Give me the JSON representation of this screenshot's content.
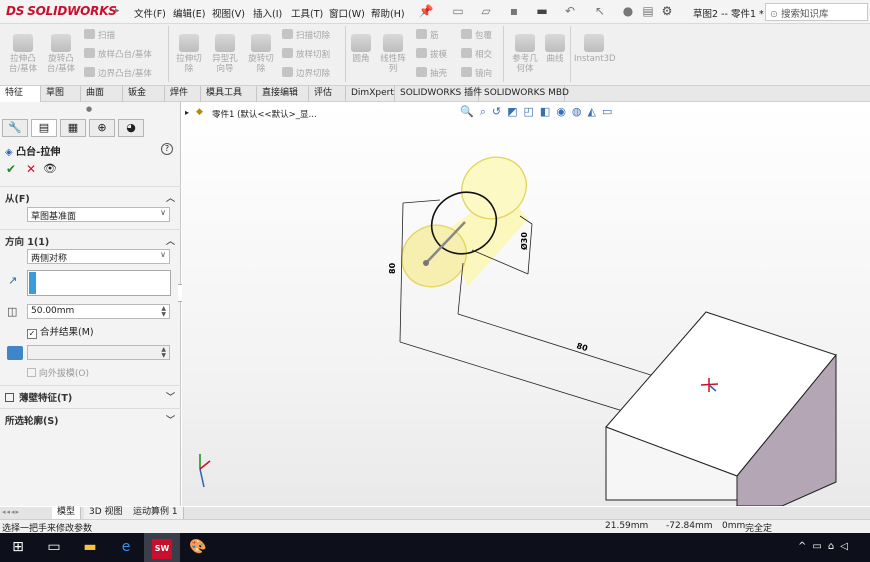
{
  "app": {
    "logo": "SOLIDWORKS",
    "logo_prefix": "DS"
  },
  "menu": [
    "文件(F)",
    "编辑(E)",
    "视图(V)",
    "插入(I)",
    "工具(T)",
    "窗口(W)",
    "帮助(H)"
  ],
  "document_title": "草图2 -- 零件1 *",
  "search_placeholder": "搜索知识库",
  "ribbon": {
    "big_buttons": [
      "拉伸凸\n台/基体",
      "旋转凸\n台/基体",
      "拉伸切\n除",
      "异型孔\n向导",
      "旋转切\n除",
      "圆角",
      "线性阵\n列",
      "参考几\n何体",
      "曲线",
      "Instant3D"
    ],
    "small_col1": [
      "扫描",
      "放样凸台/基体",
      "边界凸台/基体"
    ],
    "small_col2": [
      "扫描切除",
      "放样切割",
      "边界切除"
    ],
    "small_col3": [
      "筋",
      "拔模",
      "抽壳"
    ],
    "small_col4": [
      "包覆",
      "相交",
      "镜向"
    ]
  },
  "tabs": [
    "特征",
    "草图",
    "曲面",
    "钣金",
    "焊件",
    "模具工具",
    "直接编辑",
    "评估",
    "DimXpert",
    "SOLIDWORKS 插件",
    "SOLIDWORKS MBD"
  ],
  "active_tab": "特征",
  "tree_path": "零件1  (默认<<默认>_显...",
  "property_manager": {
    "title": "凸台-拉伸",
    "help_icon": "?",
    "from_section": {
      "label": "从(F)",
      "value": "草图基准面"
    },
    "direction_section": {
      "label": "方向 1(1)",
      "end_condition": "两侧对称",
      "depth": "50.00mm",
      "merge_label": "合并结果(M)",
      "merge_checked": true,
      "draft_label": "向外拔模(O)"
    },
    "thin_feature_label": "薄壁特征(T)",
    "selected_contours_label": "所选轮廓(S)"
  },
  "bottom_tabs": [
    "模型",
    "3D 视图",
    "运动算例 1"
  ],
  "status": {
    "message": "选择一把手来修改参数",
    "x": "21.59mm",
    "y": "-72.84mm",
    "z": "0mm",
    "state": "完全定"
  },
  "dimensions": {
    "d1": "80",
    "d2": "80",
    "d3": "Ø30"
  },
  "colors": {
    "accent": "#c8102e",
    "cylinder_fill": "#fbf7bd",
    "box_side": "#b5a6b6"
  }
}
